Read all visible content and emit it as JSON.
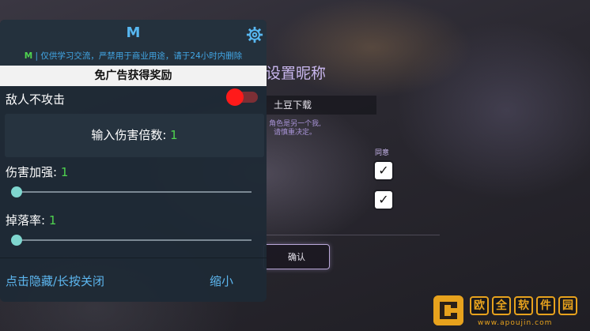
{
  "background": {
    "nickname_title": "设置昵称",
    "nickname_value": "土豆下载",
    "hint_line1": "角色是另一个我,",
    "hint_line2": "请慎重决定。",
    "agree_label": "同意",
    "confirm_label": "确认"
  },
  "mod_menu": {
    "title": "M",
    "notice_prefix": "M",
    "notice_text": " | 仅供学习交流，严禁用于商业用途，请于24小时内删除",
    "reward_label": "免广告获得奖励",
    "enemy_no_attack_label": "敌人不攻击",
    "enemy_no_attack_on": true,
    "damage_multiplier_label": "输入伤害倍数: ",
    "damage_multiplier_value": "1",
    "damage_boost_label": "伤害加强: ",
    "damage_boost_value": "1",
    "drop_rate_label": "掉落率: ",
    "drop_rate_value": "1",
    "hide_close_label": "点击隐藏/长按关闭",
    "minimize_label": "缩小"
  },
  "watermark": {
    "chars": [
      "欧",
      "全",
      "软",
      "件",
      "园"
    ],
    "url": "www.apoujin.com"
  },
  "colors": {
    "accent_blue": "#57b7f1",
    "value_green": "#4fd34f",
    "toggle_red": "#ff1a1a",
    "panel_bg": "#1e2a35",
    "watermark_orange": "#e7a21d"
  }
}
